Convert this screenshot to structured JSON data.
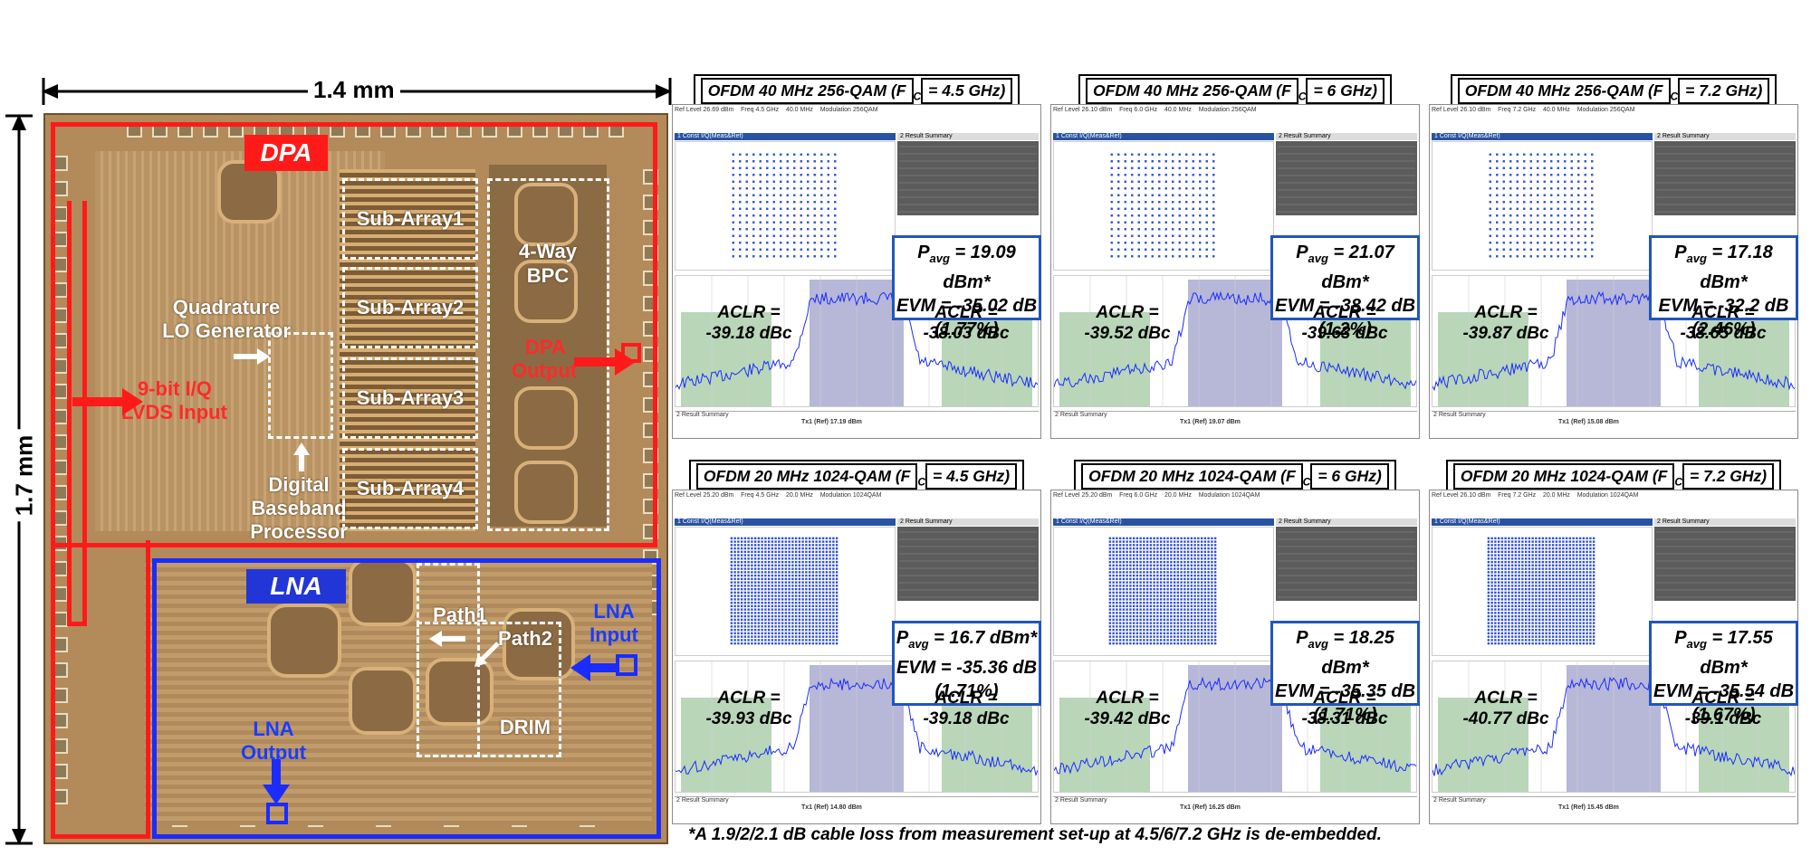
{
  "die": {
    "width_label": "1.4 mm",
    "height_label": "1.7 mm",
    "labels": {
      "dpa": "DPA",
      "lna": "LNA",
      "sub_array_1": "Sub-Array1",
      "sub_array_2": "Sub-Array2",
      "sub_array_3": "Sub-Array3",
      "sub_array_4": "Sub-Array4",
      "bpc_line1": "4-Way",
      "bpc_line2": "BPC",
      "lo_line1": "Quadrature",
      "lo_line2": "LO Generator",
      "lvds_line1": "9-bit I/Q",
      "lvds_line2": "LVDS Input",
      "dpa_out_line1": "DPA",
      "dpa_out_line2": "Output",
      "dbp_line1": "Digital",
      "dbp_line2": "Baseband",
      "dbp_line3": "Processor",
      "path1": "Path1",
      "path2": "Path2",
      "drim": "DRIM",
      "lna_in_line1": "LNA",
      "lna_in_line2": "Input",
      "lna_out_line1": "LNA",
      "lna_out_line2": "Output"
    },
    "colors": {
      "dpa": "#ff2a2a",
      "lna": "#1a3cff"
    }
  },
  "panels": [
    {
      "title_pre": "OFDM 40 MHz 256-QAM (F",
      "title_sub": "C",
      "title_post": " = 4.5 GHz)",
      "pavg": "= 19.09 dBm*",
      "evm": "EVM = -35.02 dB",
      "evm_pct": "(1.77%)",
      "aclr_left": "-39.18 dBc",
      "aclr_right": "-38.03 dBc",
      "grid": 16,
      "spectrum_top": "Tx1 (Ref) 17.19 dBm",
      "qam": "256QAM",
      "ref_level": "Ref Level 26.69 dBm",
      "freq": "Freq 4.5 GHz",
      "sym_rate": "40.0 MHz"
    },
    {
      "title_pre": "OFDM 40 MHz 256-QAM (F",
      "title_sub": "C",
      "title_post": " = 6 GHz)",
      "pavg": "= 21.07 dBm*",
      "evm": "EVM = -38.42 dB",
      "evm_pct": "(1.2%)",
      "aclr_left": "-39.52 dBc",
      "aclr_right": "-39.63 dBc",
      "grid": 16,
      "spectrum_top": "Tx1 (Ref) 19.07 dBm",
      "qam": "256QAM",
      "ref_level": "Ref Level 26.10 dBm",
      "freq": "Freq 6.0 GHz",
      "sym_rate": "40.0 MHz"
    },
    {
      "title_pre": "OFDM 40 MHz 256-QAM (F",
      "title_sub": "C",
      "title_post": " = 7.2 GHz)",
      "pavg": "= 17.18 dBm*",
      "evm": "EVM = -32.2 dB",
      "evm_pct": "(2.46%)",
      "aclr_left": "-39.87 dBc",
      "aclr_right": "-38.65 dBc",
      "grid": 16,
      "spectrum_top": "Tx1 (Ref) 15.08 dBm",
      "qam": "256QAM",
      "ref_level": "Ref Level 26.10 dBm",
      "freq": "Freq 7.2 GHz",
      "sym_rate": "40.0 MHz"
    },
    {
      "title_pre": "OFDM 20 MHz 1024-QAM (F",
      "title_sub": "C",
      "title_post": " = 4.5 GHz)",
      "pavg": "= 16.7 dBm*",
      "evm": "EVM = -35.36 dB",
      "evm_pct": "(1.71%)",
      "aclr_left": "-39.93 dBc",
      "aclr_right": "-39.18 dBc",
      "grid": 32,
      "spectrum_top": "Tx1 (Ref) 14.80 dBm",
      "qam": "1024QAM",
      "ref_level": "Ref Level 25.20 dBm",
      "freq": "Freq 4.5 GHz",
      "sym_rate": "20.0 MHz"
    },
    {
      "title_pre": "OFDM 20 MHz 1024-QAM (F",
      "title_sub": "C",
      "title_post": " = 6 GHz)",
      "pavg": "= 18.25 dBm*",
      "evm": "EVM = -35.35 dB",
      "evm_pct": "(1.71%)",
      "aclr_left": "-39.42 dBc",
      "aclr_right": "-38.31 dBc",
      "grid": 32,
      "spectrum_top": "Tx1 (Ref) 16.25 dBm",
      "qam": "1024QAM",
      "ref_level": "Ref Level 25.20 dBm",
      "freq": "Freq 6.0 GHz",
      "sym_rate": "20.0 MHz"
    },
    {
      "title_pre": "OFDM 20 MHz 1024-QAM (F",
      "title_sub": "C",
      "title_post": " = 7.2 GHz)",
      "pavg": "= 17.55 dBm*",
      "evm": "EVM = -35.54 dB",
      "evm_pct": "(1.67%)",
      "aclr_left": "-40.77 dBc",
      "aclr_right": "-39.1 dBc",
      "grid": 32,
      "spectrum_top": "Tx1 (Ref) 15.45 dBm",
      "qam": "1024QAM",
      "ref_level": "Ref Level 26.10 dBm",
      "freq": "Freq 7.2 GHz",
      "sym_rate": "20.0 MHz"
    }
  ],
  "common": {
    "pavg_prefix": "P",
    "pavg_sub": "avg",
    "aclr_label": "ACLR =",
    "const_title": "1 Const I/Q(Meas&Ref)",
    "result_title": "2 Result Summary",
    "mod_label": "Modulation",
    "bottom_label": "2 Result Summary"
  },
  "footnote": "*A 1.9/2/2.1 dB cable loss from measurement set-up at 4.5/6/7.2 GHz is de-embedded."
}
